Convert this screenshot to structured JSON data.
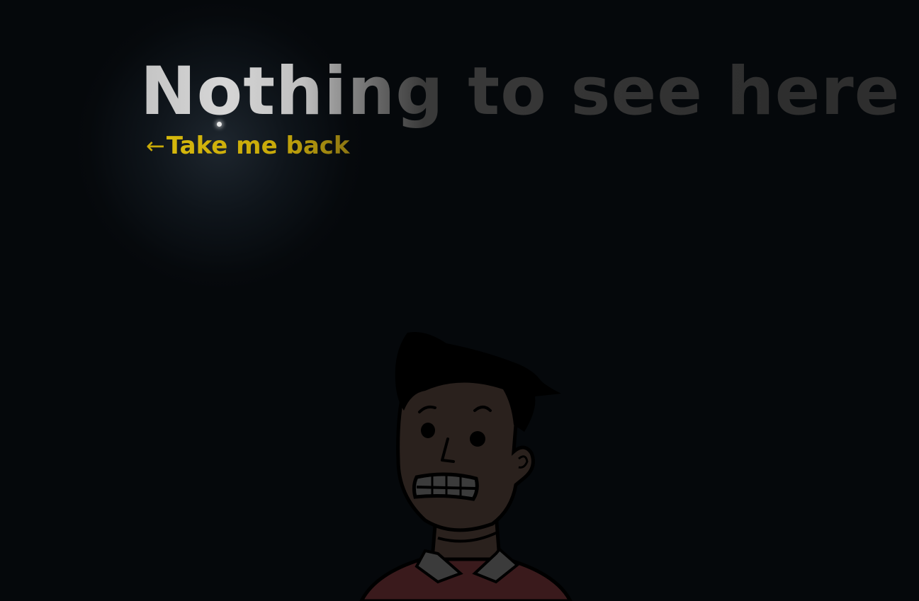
{
  "page": {
    "headline": "Nothing to see here",
    "back_link": {
      "arrow": "←",
      "label": "Take me back"
    }
  },
  "illustration": {
    "name": "scared-man",
    "colors": {
      "background": "#05080b",
      "skin": "#2a211d",
      "hair": "#000000",
      "shirt": "#3a1a1c",
      "collar": "#3b3b3b",
      "accent": "#c9aa08"
    }
  }
}
